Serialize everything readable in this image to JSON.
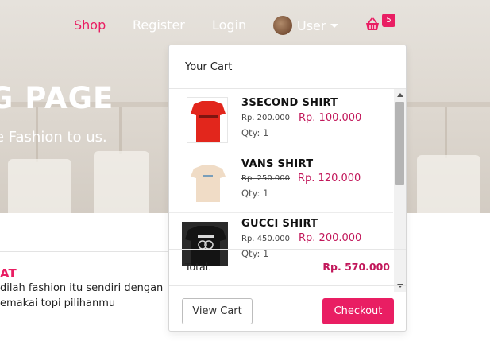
{
  "nav": {
    "shop": "Shop",
    "register": "Register",
    "login": "Login",
    "user": "User",
    "cart_count": "5"
  },
  "hero": {
    "title": "G PAGE",
    "subtitle": "e Fashion to us."
  },
  "info": {
    "title": "AT",
    "line1": "dilah fashion itu sendiri dengan",
    "line2": "emakai topi pilihanmu"
  },
  "cart": {
    "header": "Your Cart",
    "items": [
      {
        "name": "3SECOND SHIRT",
        "old_price": "Rp. 200.000",
        "price": "Rp. 100.000",
        "qty": "Qty: 1",
        "thumb_color": "#e2261c"
      },
      {
        "name": "VANS SHIRT",
        "old_price": "Rp. 250.000",
        "price": "Rp. 120.000",
        "qty": "Qty: 1",
        "thumb_color": "#f0dcc6"
      },
      {
        "name": "GUCCI SHIRT",
        "old_price": "Rp. 450.000",
        "price": "Rp. 200.000",
        "qty": "Qty: 1",
        "thumb_color": "#1b1b1b"
      }
    ],
    "total_label": "Total:",
    "total_value": "Rp. 570.000",
    "view_cart": "View Cart",
    "checkout": "Checkout"
  },
  "colors": {
    "accent": "#e91e63",
    "price": "#c2185b"
  }
}
